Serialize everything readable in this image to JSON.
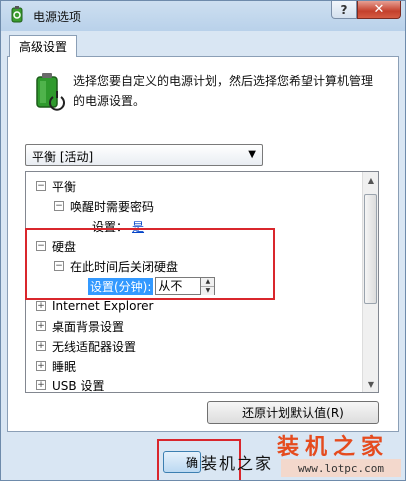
{
  "window": {
    "title": "电源选项",
    "help_label": "?",
    "close_label": "✕"
  },
  "tab": {
    "label": "高级设置"
  },
  "description": "选择您要自定义的电源计划，然后选择您希望计算机管理的电源设置。",
  "plan_select": {
    "value": "平衡 [活动]"
  },
  "tree": {
    "items": [
      {
        "toggle": "⊟",
        "label": "平衡"
      },
      {
        "toggle": "⊟",
        "label": "唤醒时需要密码"
      },
      {
        "prefix": "设置：",
        "value": "是"
      },
      {
        "toggle": "⊟",
        "label": "硬盘"
      },
      {
        "toggle": "⊟",
        "label": "在此时间后关闭硬盘"
      },
      {
        "prefix": "设置(分钟):",
        "value": "从不"
      },
      {
        "toggle": "⊞",
        "label": "Internet Explorer"
      },
      {
        "toggle": "⊞",
        "label": "桌面背景设置"
      },
      {
        "toggle": "⊞",
        "label": "无线适配器设置"
      },
      {
        "toggle": "⊞",
        "label": "睡眠"
      },
      {
        "toggle": "⊞",
        "label": "USB 设置"
      }
    ]
  },
  "buttons": {
    "restore": "还原计划默认值(R)",
    "ok": "确"
  },
  "watermark": {
    "brand": "装机之家",
    "overlay": "装机之家",
    "url": "www.lotpc.com"
  },
  "colors": {
    "accent_red": "#d9262c",
    "selection_blue": "#3399ff",
    "watermark_orange": "#e54b1e"
  }
}
